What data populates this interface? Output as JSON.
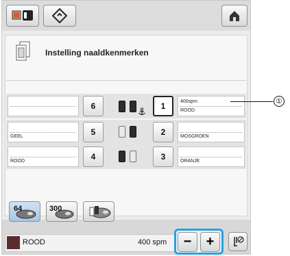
{
  "header": {
    "home_icon": "home-icon",
    "embroidery_icon": "embroidery-machine-icon",
    "diamond_icon": "diamond-tool-icon"
  },
  "panel": {
    "title": "Instelling naaldkenmerken",
    "title_icon": "thread-spool-document-icon"
  },
  "needles": {
    "left": [
      {
        "number": "6",
        "color_name": "",
        "spools": [
          "dark",
          "dark"
        ],
        "anchor": true
      },
      {
        "number": "5",
        "color_name": "GEEL",
        "spools": [
          "light",
          "dark"
        ],
        "anchor": false
      },
      {
        "number": "4",
        "color_name": "ROOD",
        "spools": [
          "dark",
          "light"
        ],
        "anchor": false
      }
    ],
    "right": [
      {
        "number": "1",
        "speed": "400spm",
        "color_name": "ROOD",
        "selected": true
      },
      {
        "number": "2",
        "speed": "",
        "color_name": "MOSGROEN",
        "selected": false
      },
      {
        "number": "3",
        "speed": "",
        "color_name": "ORANJE",
        "selected": false
      }
    ]
  },
  "toolbar": {
    "btn64_label": "64",
    "btn300_label": "300"
  },
  "status": {
    "color_name": "ROOD",
    "speed": "400 spm",
    "swatch_color": "#5a2d2d",
    "minus_label": "−",
    "plus_label": "+"
  },
  "callout": {
    "label": "①"
  }
}
